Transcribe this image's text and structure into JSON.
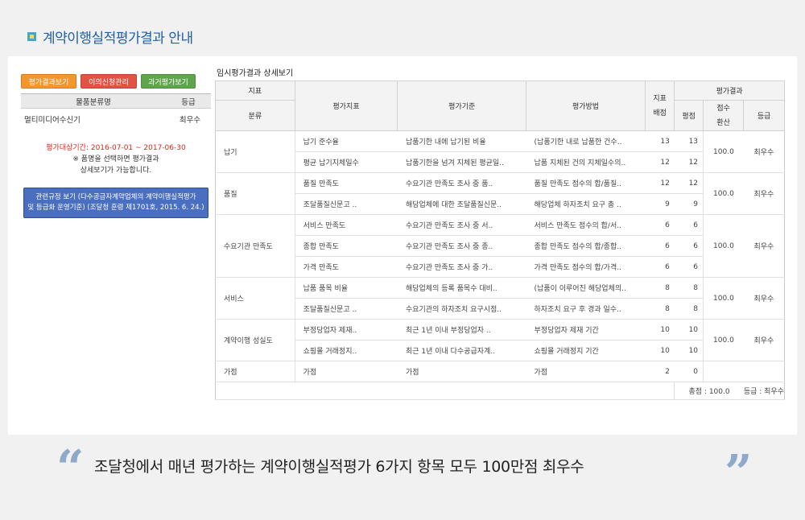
{
  "header": {
    "title": "계약이행실적평가결과 안내"
  },
  "left": {
    "buttons": [
      "평가결과보기",
      "이의신청관리",
      "과거평가보기"
    ],
    "table_headers": [
      "물품분류명",
      "등급"
    ],
    "row": {
      "name": "멀티미디어수신기",
      "grade": "최우수"
    },
    "period_label": "평가대상기간: 2016-07-01 ~ 2017-06-30",
    "note1": "※ 품명을 선택하면 평가결과",
    "note2": "상세보기가 가능합니다.",
    "rule_line1": "관련규정 보기 (다수공급자계약업체의 계약이행실적평가",
    "rule_line2": "및 등급화 운영기준) (조달청 훈령 제1701호, 2015. 6. 24.)"
  },
  "results": {
    "title": "임시평가결과 상세보기",
    "headers": {
      "jipyo": "지표",
      "bunryu": "분류",
      "pyeongga_jipyo": "평가지표",
      "gijun": "평가기준",
      "bangbeop": "평가방법",
      "baejeom": "지표\n배점",
      "gyeolgwa": "평가결과",
      "pyeongjeom": "평점",
      "jeomsu": "점수\n환산",
      "grade": "등급"
    },
    "groups": [
      {
        "category": "납기",
        "score": "100.0",
        "grade": "최우수",
        "rows": [
          {
            "indicator": "납기 준수율",
            "criterion": "납품기한 내에 납기된 비율",
            "method": "(납품기한 내로 납품한 건수..",
            "alloc": "13",
            "points": "13"
          },
          {
            "indicator": "평균 납기지체일수",
            "criterion": "납품기한을 넘겨 지체된 평균일..",
            "method": "납품 지체된 건의 지체일수의..",
            "alloc": "12",
            "points": "12"
          }
        ]
      },
      {
        "category": "품질",
        "score": "100.0",
        "grade": "최우수",
        "rows": [
          {
            "indicator": "품질 만족도",
            "criterion": "수요기관 만족도 조사 중 품..",
            "method": "품질 만족도 점수의 합/품질..",
            "alloc": "12",
            "points": "12"
          },
          {
            "indicator": "조달품질신문고 ..",
            "criterion": "해당업체에 대한 조달품질신문..",
            "method": "해당업체 하자조치 요구 총 ..",
            "alloc": "9",
            "points": "9"
          }
        ]
      },
      {
        "category": "수요기관 만족도",
        "score": "100.0",
        "grade": "최우수",
        "rows": [
          {
            "indicator": "서비스 만족도",
            "criterion": "수요기관 만족도 조사 중 서..",
            "method": "서비스 만족도 점수의 합/서..",
            "alloc": "6",
            "points": "6"
          },
          {
            "indicator": "종합 만족도",
            "criterion": "수요기관 만족도 조사 중 종..",
            "method": "종합 만족도 점수의 합/종합..",
            "alloc": "6",
            "points": "6"
          },
          {
            "indicator": "가격 만족도",
            "criterion": "수요기관 만족도 조사 중 가..",
            "method": "가격 만족도 점수의 합/가격..",
            "alloc": "6",
            "points": "6"
          }
        ]
      },
      {
        "category": "서비스",
        "score": "100.0",
        "grade": "최우수",
        "rows": [
          {
            "indicator": "납품 품목 비율",
            "criterion": "해당업체의 등록 품목수 대비..",
            "method": "(납품이 이루어진 해당업체의..",
            "alloc": "8",
            "points": "8"
          },
          {
            "indicator": "조달품질신문고 ..",
            "criterion": "수요기관의 하자조치 요구시점..",
            "method": "하자조치 요구 후 경과 일수..",
            "alloc": "8",
            "points": "8"
          }
        ]
      },
      {
        "category": "계약이행 성실도",
        "score": "100.0",
        "grade": "최우수",
        "rows": [
          {
            "indicator": "부정당업자 제재..",
            "criterion": "최근 1년 이내 부정당업자 ..",
            "method": "부정당업자 제재 기간",
            "alloc": "10",
            "points": "10"
          },
          {
            "indicator": "쇼핑몰 거래정지..",
            "criterion": "최근 1년 이내 다수공급자계..",
            "method": "쇼핑몰 거래정지 기간",
            "alloc": "10",
            "points": "10"
          }
        ]
      },
      {
        "category": "가점",
        "score": "",
        "grade": "",
        "rows": [
          {
            "indicator": "가점",
            "criterion": "가점",
            "method": "가점",
            "alloc": "2",
            "points": "0"
          }
        ]
      }
    ],
    "total_label": "총점 : 100.0",
    "grade_label": "등급 : 최우수"
  },
  "quote": "조달청에서 매년 평가하는 계약이행실적평가 6가지 항목 모두 100만점 최우수",
  "quote_open": "“",
  "quote_close": "”"
}
